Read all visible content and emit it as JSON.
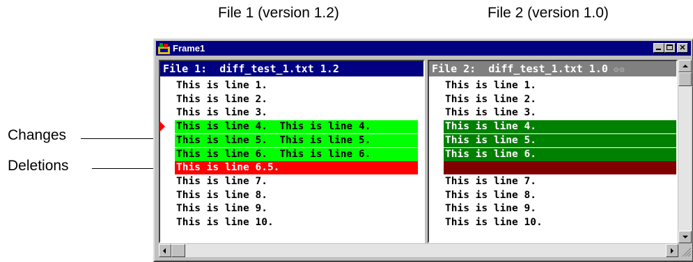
{
  "captions": {
    "file1": "File 1 (version 1.2)",
    "file2": "File 2 (version 1.0)"
  },
  "callouts": {
    "changes": "Changes",
    "deletions": "Deletions"
  },
  "window": {
    "title": "Frame1"
  },
  "left_pane": {
    "header": "File 1:  diff_test_1.txt 1.2",
    "lines": [
      {
        "text": "This is line 1.",
        "status": "same"
      },
      {
        "text": "This is line 2.",
        "status": "same"
      },
      {
        "text": "This is line 3.",
        "status": "same"
      },
      {
        "text": "This is line 4.  This is line 4.",
        "status": "changed"
      },
      {
        "text": "This is line 5.  This is line 5.",
        "status": "changed"
      },
      {
        "text": "This is line 6.  This is line 6.",
        "status": "changed"
      },
      {
        "text": "This is line 6.5.",
        "status": "deleted"
      },
      {
        "text": "This is line 7.",
        "status": "same"
      },
      {
        "text": "This is line 8.",
        "status": "same"
      },
      {
        "text": "This is line 9.",
        "status": "same"
      },
      {
        "text": "This is line 10.",
        "status": "same"
      }
    ]
  },
  "right_pane": {
    "header": "File 2:  diff_test_1.txt 1.0",
    "lines": [
      {
        "text": "This is line 1.",
        "status": "same"
      },
      {
        "text": "This is line 2.",
        "status": "same"
      },
      {
        "text": "This is line 3.",
        "status": "same"
      },
      {
        "text": "This is line 4.",
        "status": "changed"
      },
      {
        "text": "This is line 5.",
        "status": "changed"
      },
      {
        "text": "This is line 6.",
        "status": "changed"
      },
      {
        "text": "",
        "status": "deleted"
      },
      {
        "text": "This is line 7.",
        "status": "same"
      },
      {
        "text": "This is line 8.",
        "status": "same"
      },
      {
        "text": "This is line 9.",
        "status": "same"
      },
      {
        "text": "This is line 10.",
        "status": "same"
      }
    ]
  },
  "colors": {
    "active_header": "#000080",
    "inactive_header": "#808080",
    "left_changed": "#00ff00",
    "left_deleted": "#ff0000",
    "right_changed": "#008000",
    "right_deleted": "#800000",
    "marker": "#ff0000"
  }
}
